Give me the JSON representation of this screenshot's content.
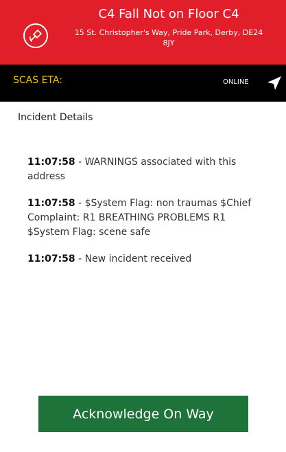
{
  "header": {
    "title": "C4 Fall Not on Floor C4",
    "address": "15 St. Christopher's Way, Pride Park, Derby, DE24 8JY",
    "icon": "alert-hand-icon"
  },
  "eta_bar": {
    "label": "SCAS ETA:",
    "status": "ONLINE",
    "icon": "navigation-arrow-icon"
  },
  "incident": {
    "section_title": "Incident Details",
    "entries": [
      {
        "time": "11:07:58",
        "separator": " - ",
        "text": "WARNINGS associated with this address"
      },
      {
        "time": "11:07:58",
        "separator": " - ",
        "text": "$System Flag: non traumas $Chief Complaint: R1 BREATHING PROBLEMS R1 $System Flag: scene safe"
      },
      {
        "time": "11:07:58",
        "separator": " - ",
        "text": "New incident received"
      }
    ]
  },
  "actions": {
    "acknowledge_label": "Acknowledge On Way"
  },
  "colors": {
    "header_bg": "#e01f2a",
    "eta_bar_bg": "#000000",
    "eta_label": "#f2c200",
    "button_bg": "#1d7339"
  }
}
